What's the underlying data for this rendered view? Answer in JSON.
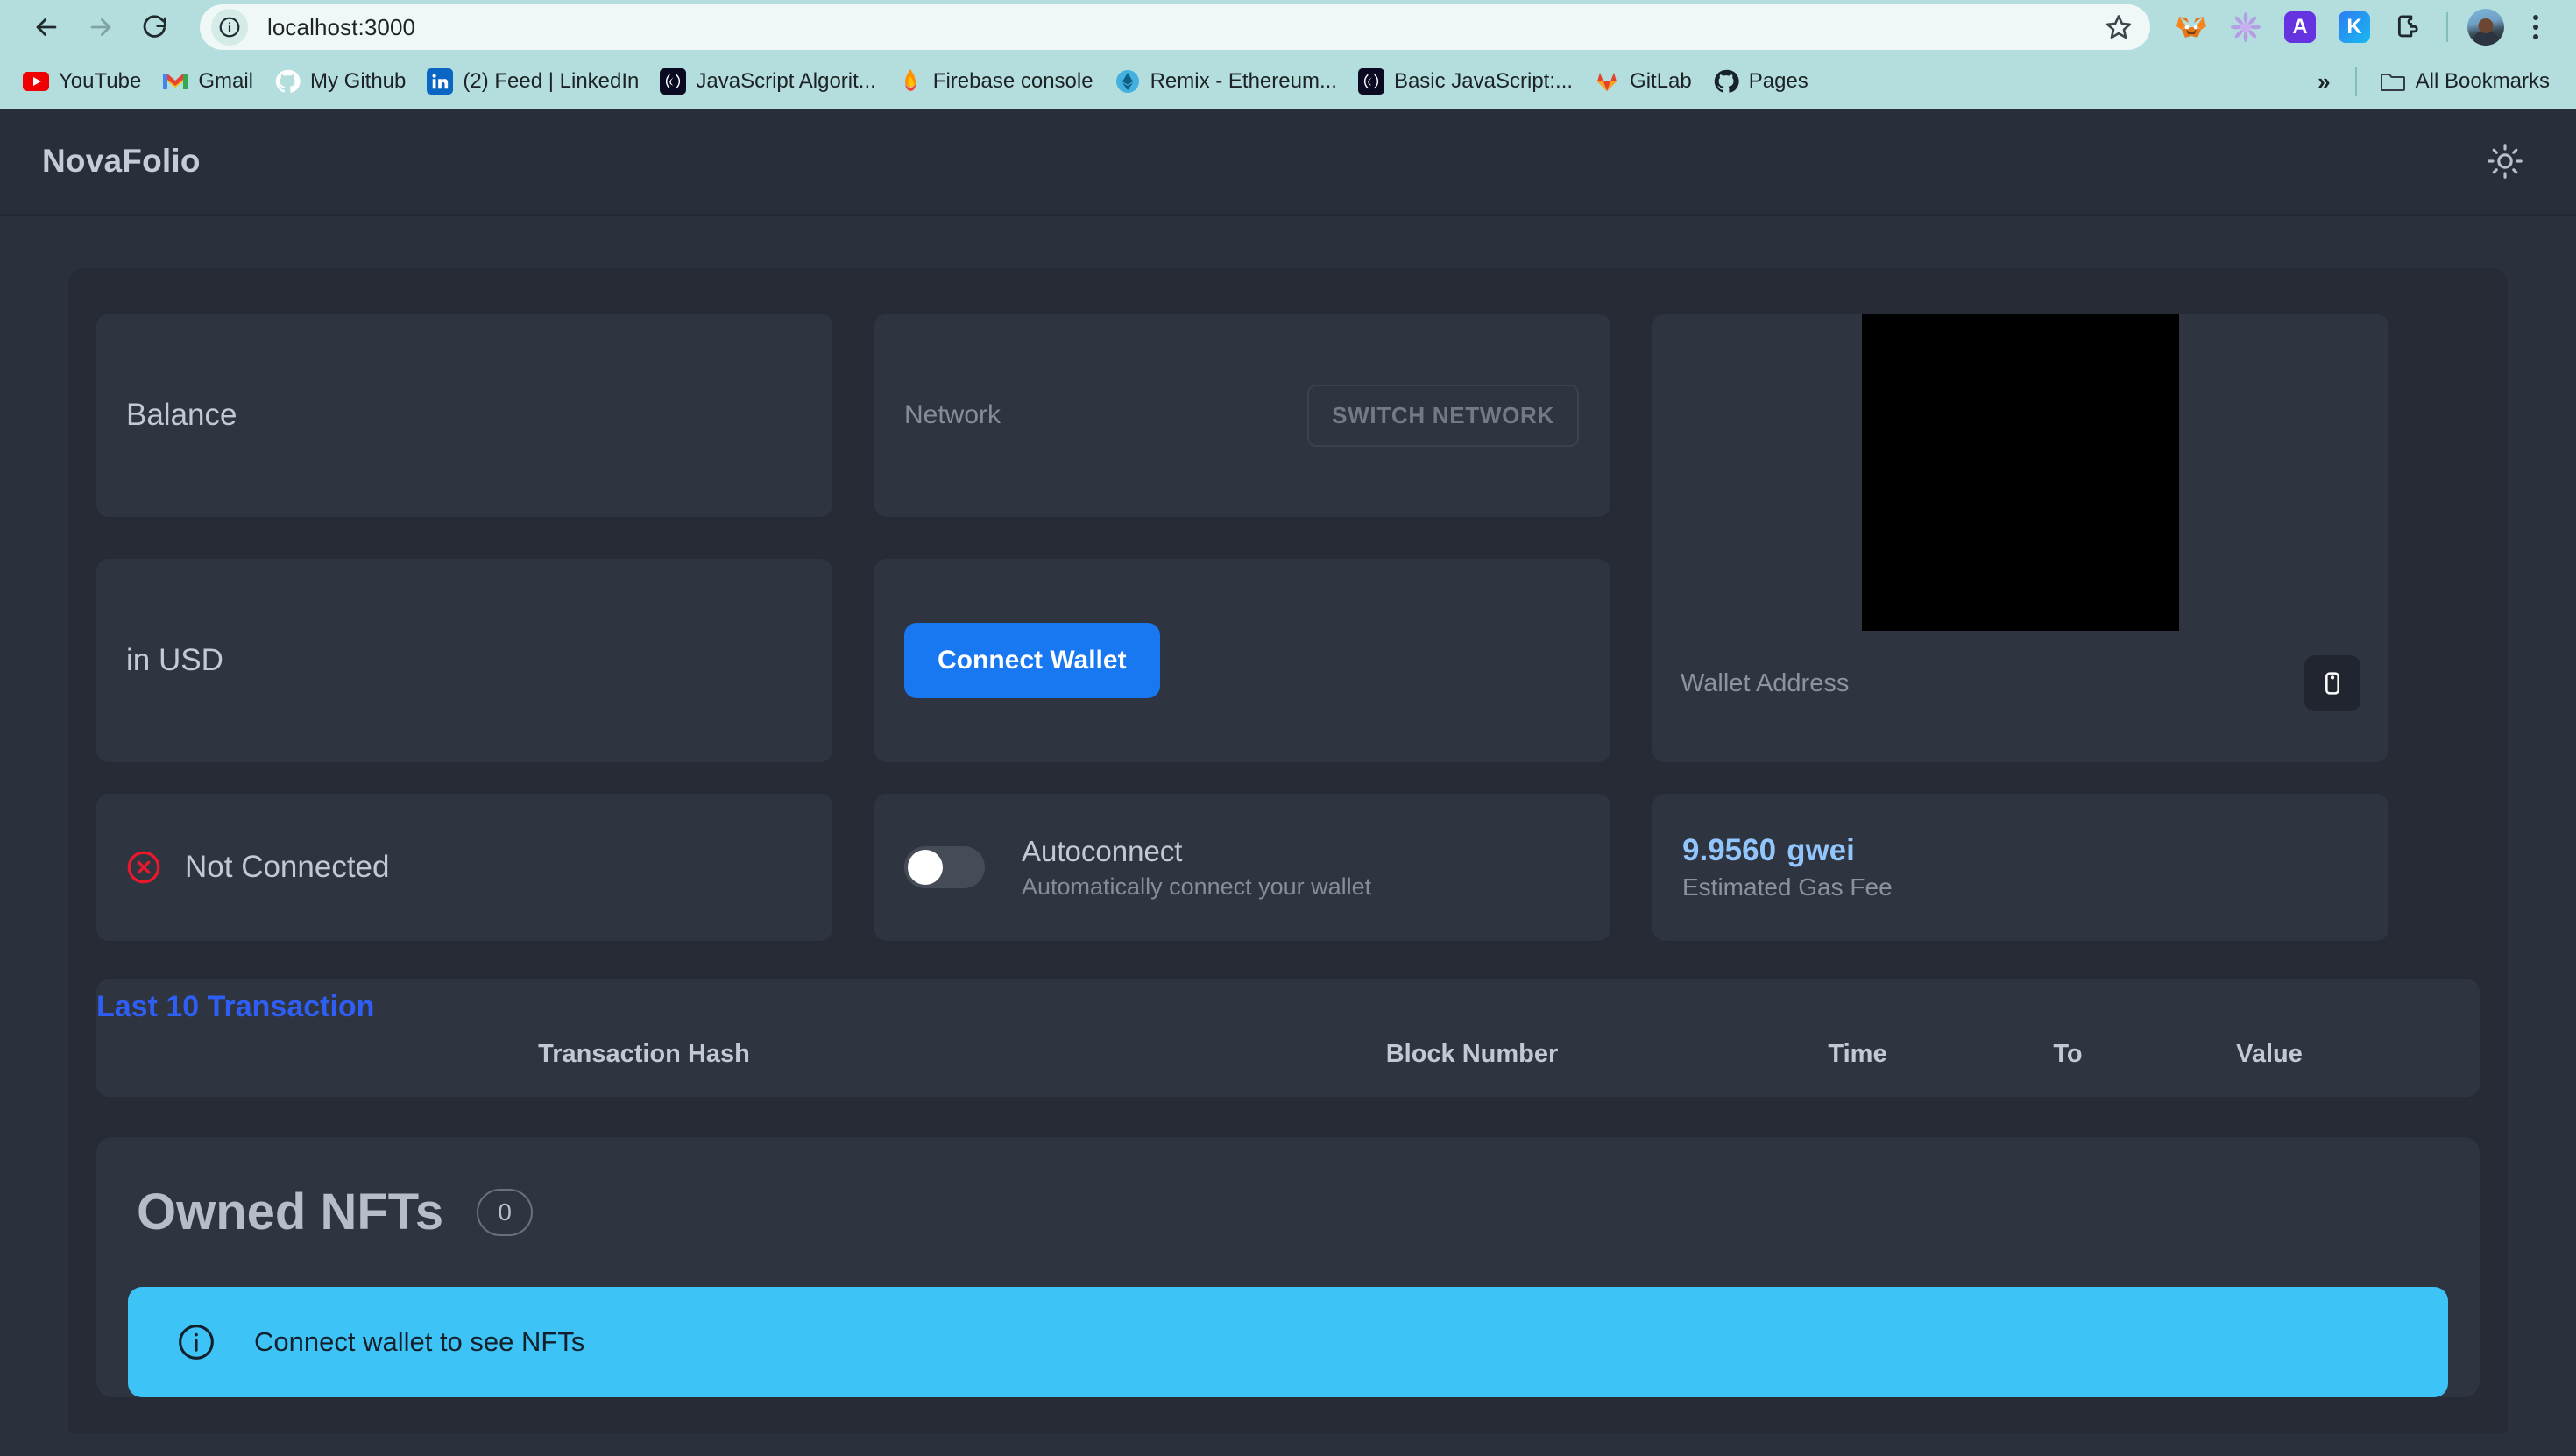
{
  "browser": {
    "nav": {
      "back": "back-arrow",
      "forward": "forward-arrow",
      "reload": "reload"
    },
    "omnibox": {
      "url": "localhost:3000",
      "site_info_icon": "info-circle-icon",
      "star_icon": "star-icon"
    },
    "extensions": [
      {
        "name": "metamask",
        "label": "",
        "bg": ""
      },
      {
        "name": "flower-extension",
        "label": "",
        "bg": ""
      },
      {
        "name": "a-extension",
        "label": "A",
        "bg": "#6534e0"
      },
      {
        "name": "k-extension",
        "label": "K",
        "bg": "#1fa7f0"
      },
      {
        "name": "extensions-puzzle",
        "label": "",
        "bg": ""
      }
    ],
    "bookmarks": [
      {
        "label": "YouTube",
        "icon": "youtube-icon"
      },
      {
        "label": "Gmail",
        "icon": "gmail-icon"
      },
      {
        "label": "My Github",
        "icon": "github-icon"
      },
      {
        "label": "(2) Feed | LinkedIn",
        "icon": "linkedin-icon"
      },
      {
        "label": "JavaScript Algorit...",
        "icon": "freecodecamp-icon"
      },
      {
        "label": "Firebase console",
        "icon": "firebase-icon"
      },
      {
        "label": "Remix - Ethereum...",
        "icon": "ethereum-icon"
      },
      {
        "label": "Basic JavaScript:...",
        "icon": "freecodecamp-icon"
      },
      {
        "label": "GitLab",
        "icon": "gitlab-icon"
      },
      {
        "label": "Pages",
        "icon": "github-icon"
      }
    ],
    "overflow_label": "»",
    "all_bookmarks_label": "All Bookmarks"
  },
  "app": {
    "brand": "NovaFolio",
    "theme_toggle_icon": "sun-icon",
    "colors": {
      "page_bg": "#2a303c",
      "panel_bg": "#262b35",
      "card_bg": "#2e3440",
      "accent_blue": "#1778f2",
      "tx_title_blue": "#2f5ef5",
      "gas_blue": "#93c5fd",
      "alert_blue": "#3ec3f7",
      "error_red": "#e8192c"
    },
    "cards": {
      "balance_label": "Balance",
      "network_label": "Network",
      "switch_network_label": "SWITCH NETWORK",
      "usd_label": "in USD",
      "connect_wallet_label": "Connect Wallet",
      "status_label": "Not Connected",
      "status_icon": "error-circle-x-icon",
      "autoconnect_title": "Autoconnect",
      "autoconnect_subtitle": "Automatically connect your wallet",
      "autoconnect_state": "off",
      "gas_value": "9.9560",
      "gas_unit": "gwei",
      "gas_sub": "Estimated Gas Fee",
      "wallet_address_label": "Wallet Address",
      "copy_icon": "clipboard-icon",
      "qr_placeholder": "qr-code"
    },
    "transactions": {
      "title": "Last 10 Transaction",
      "columns": [
        "Transaction Hash",
        "Block Number",
        "Time",
        "To",
        "Value"
      ],
      "rows": []
    },
    "nfts": {
      "title": "Owned NFTs",
      "count": "0",
      "alert_icon": "info-circle-icon",
      "alert_text": "Connect wallet to see NFTs"
    }
  }
}
